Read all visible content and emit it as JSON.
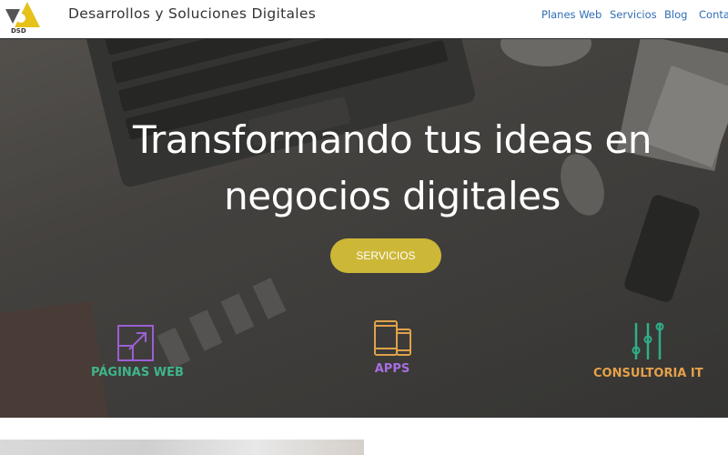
{
  "brand": {
    "logo_text": "DSD",
    "name": "Desarrollos y Soluciones Digitales"
  },
  "nav": {
    "items": [
      "Planes Web",
      "Servicios",
      "Blog",
      "Conta"
    ]
  },
  "hero": {
    "title_line1": "Transformando tus ideas en",
    "title_line2": "negocios digitales",
    "cta_label": "SERVICIOS"
  },
  "services": [
    {
      "label": "PÁGINAS WEB",
      "icon": "expand-arrow-icon",
      "color": "#3fb58a",
      "icon_color": "#9a5fd6"
    },
    {
      "label": "APPS",
      "icon": "devices-icon",
      "color": "#a86ee0",
      "icon_color": "#e0a24a"
    },
    {
      "label": "CONSULTORIA IT",
      "icon": "sliders-icon",
      "color": "#e5a14a",
      "icon_color": "#2fae88"
    }
  ],
  "colors": {
    "accent": "#cdb737",
    "nav_link": "#2f6db5"
  }
}
